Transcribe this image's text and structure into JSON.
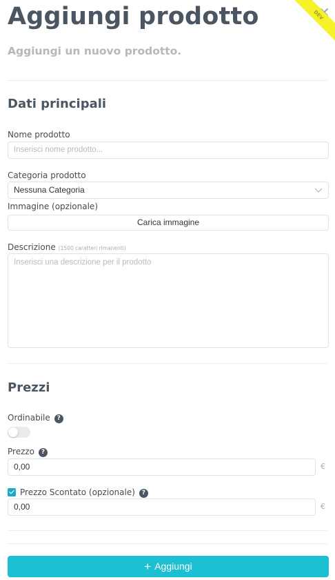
{
  "header": {
    "title": "Aggiungi prodotto",
    "subtitle": "Aggiungi un nuovo prodotto.",
    "close_icon": "close-icon",
    "ribbon": "DEV"
  },
  "main_section": {
    "title": "Dati principali",
    "product_name": {
      "label": "Nome prodotto",
      "placeholder": "Inserisci nome prodotto..."
    },
    "category": {
      "label": "Categoria prodotto",
      "value": "Nessuna Categoria"
    },
    "image": {
      "label": "Immagine (opzionale)",
      "button": "Carica immagine"
    },
    "description": {
      "label": "Descrizione",
      "hint": "(1500 caratteri rimanenti)",
      "placeholder": "Inserisci una descrizione per il prodotto"
    }
  },
  "prices_section": {
    "title": "Prezzi",
    "orderable": {
      "label": "Ordinabile",
      "on": false
    },
    "price": {
      "label": "Prezzo",
      "value": "0,00",
      "currency": "€"
    },
    "discount": {
      "label": "Prezzo Scontato (opzionale)",
      "checked": true,
      "value": "0,00",
      "currency": "€"
    }
  },
  "footer": {
    "submit_label": "Aggiungi"
  },
  "colors": {
    "accent": "#1dbfd3",
    "checkbox": "#1fa8c7",
    "heading": "#4c5562",
    "ribbon": "#f6f22a"
  }
}
